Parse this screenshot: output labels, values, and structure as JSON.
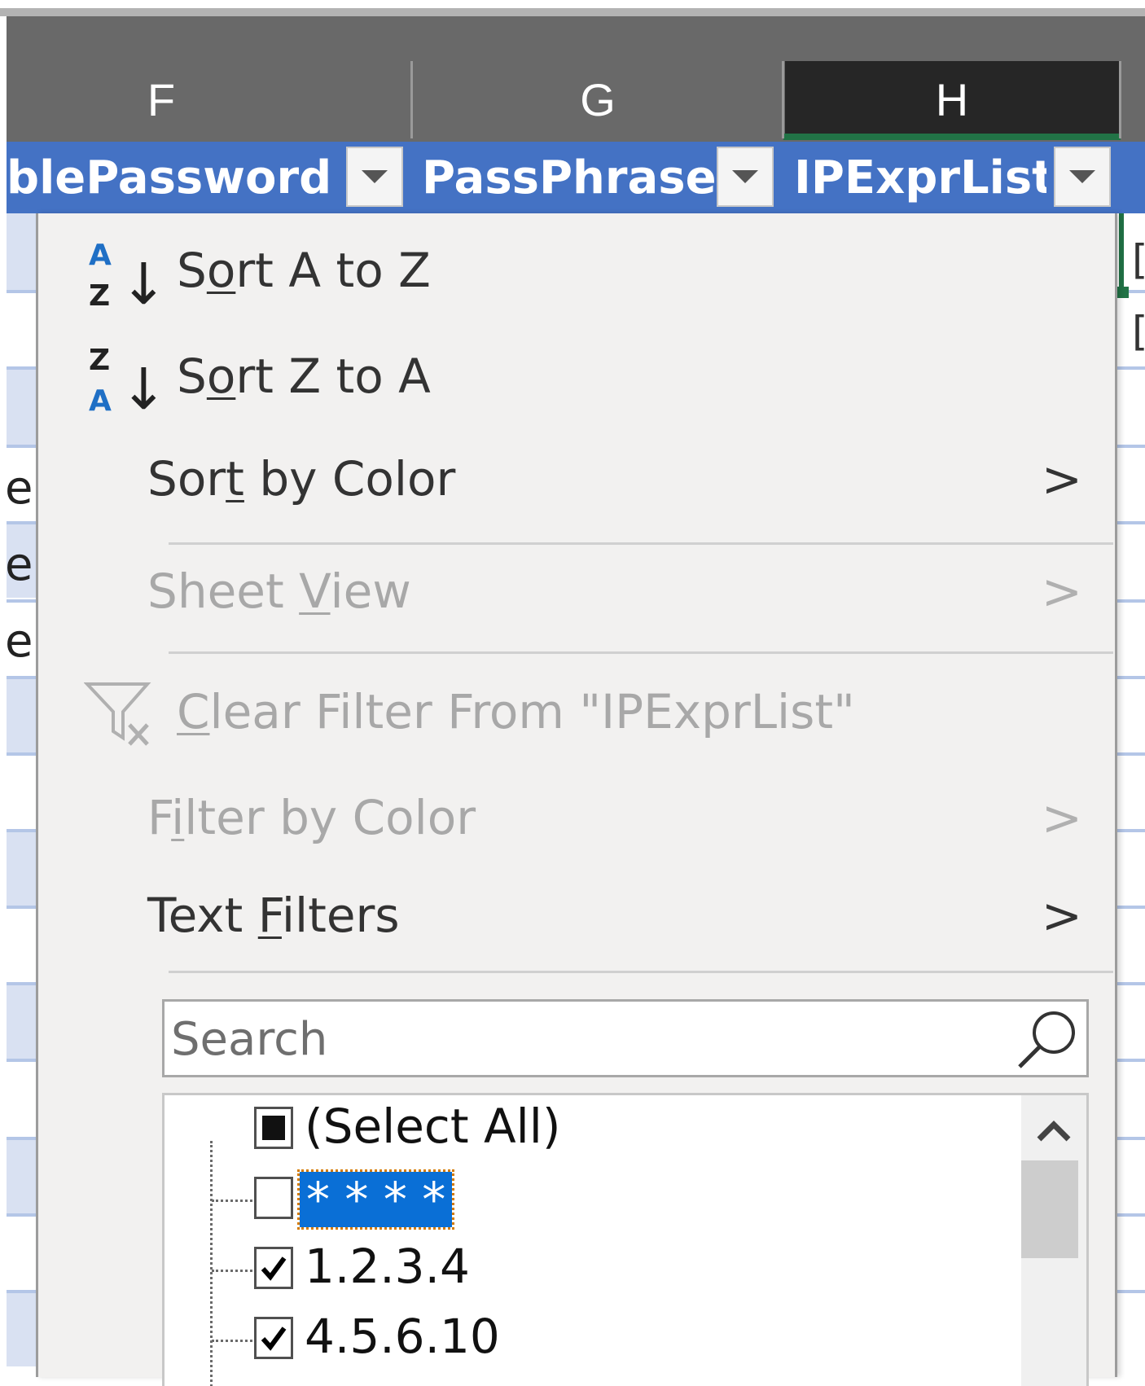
{
  "columns": {
    "f": "F",
    "g": "G",
    "h": "H"
  },
  "table_headers": {
    "f": "blePassword",
    "g": "PassPhrase",
    "h": "IPExprList"
  },
  "left_cells": [
    "e",
    "e",
    "e"
  ],
  "right_cells": [
    "[",
    "["
  ],
  "menu": {
    "sort_az": {
      "pre": "S",
      "u": "o",
      "post": "rt A to Z"
    },
    "sort_za": {
      "pre": "S",
      "u": "o",
      "post": "rt Z to A"
    },
    "sort_color": {
      "pre": "Sor",
      "u": "t",
      "post": " by Color"
    },
    "sheet_view": {
      "pre": "Sheet ",
      "u": "V",
      "post": "iew"
    },
    "clear_filter": {
      "pre": "",
      "u": "C",
      "post": "lear Filter From \"IPExprList\""
    },
    "filter_color": {
      "pre": "F",
      "u": "i",
      "post": "lter by Color"
    },
    "text_filters": {
      "pre": "Text ",
      "u": "F",
      "post": "ilters"
    },
    "chevron": ">"
  },
  "icons": {
    "sort_az_top": "A",
    "sort_az_bottom": "Z",
    "sort_za_top": "Z",
    "sort_za_bottom": "A",
    "arrow": "↓"
  },
  "search": {
    "placeholder": "Search"
  },
  "filter_list": [
    {
      "label": "(Select All)",
      "state": "partial"
    },
    {
      "label": "* * * *",
      "state": "unchecked"
    },
    {
      "label": "1.2.3.4",
      "state": "checked"
    },
    {
      "label": "4.5.6.10",
      "state": "checked"
    }
  ],
  "colors": {
    "table_header": "#4472c4",
    "menu_bg": "#f2f1f0",
    "selected_item": "#0a6fd6",
    "active_column": "#262626",
    "selection_green": "#217346"
  }
}
